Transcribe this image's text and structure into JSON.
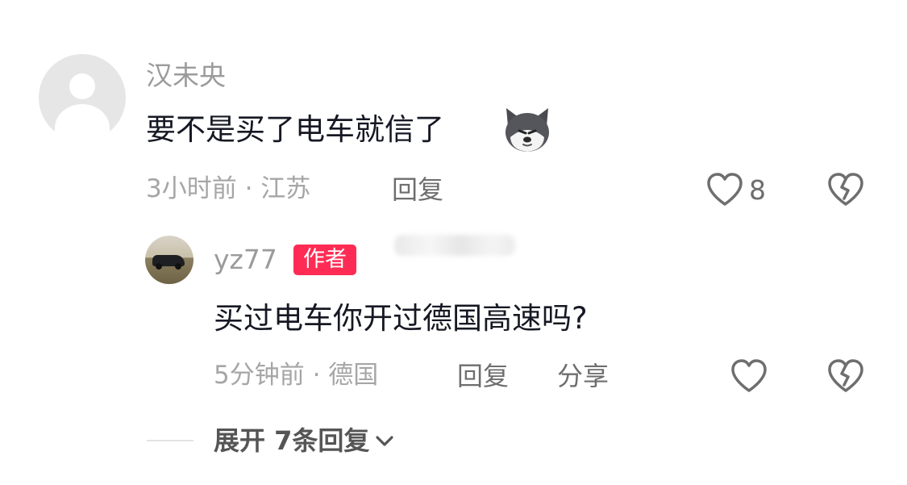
{
  "comment": {
    "username": "汉未央",
    "text": "要不是买了电车就信了",
    "emoji": "husky-face",
    "time_location": "3小时前 · 江苏",
    "reply_label": "回复",
    "like_count": "8"
  },
  "reply": {
    "username": "yz77",
    "author_badge": "作者",
    "text": "买过电车你开过德国高速吗?",
    "time_location": "5分钟前 · 德国",
    "reply_label": "回复",
    "share_label": "分享"
  },
  "expand": {
    "label": "展开 7条回复"
  },
  "colors": {
    "badge": "#fe2c55",
    "text": "#161823",
    "meta": "#a6a6a6"
  }
}
